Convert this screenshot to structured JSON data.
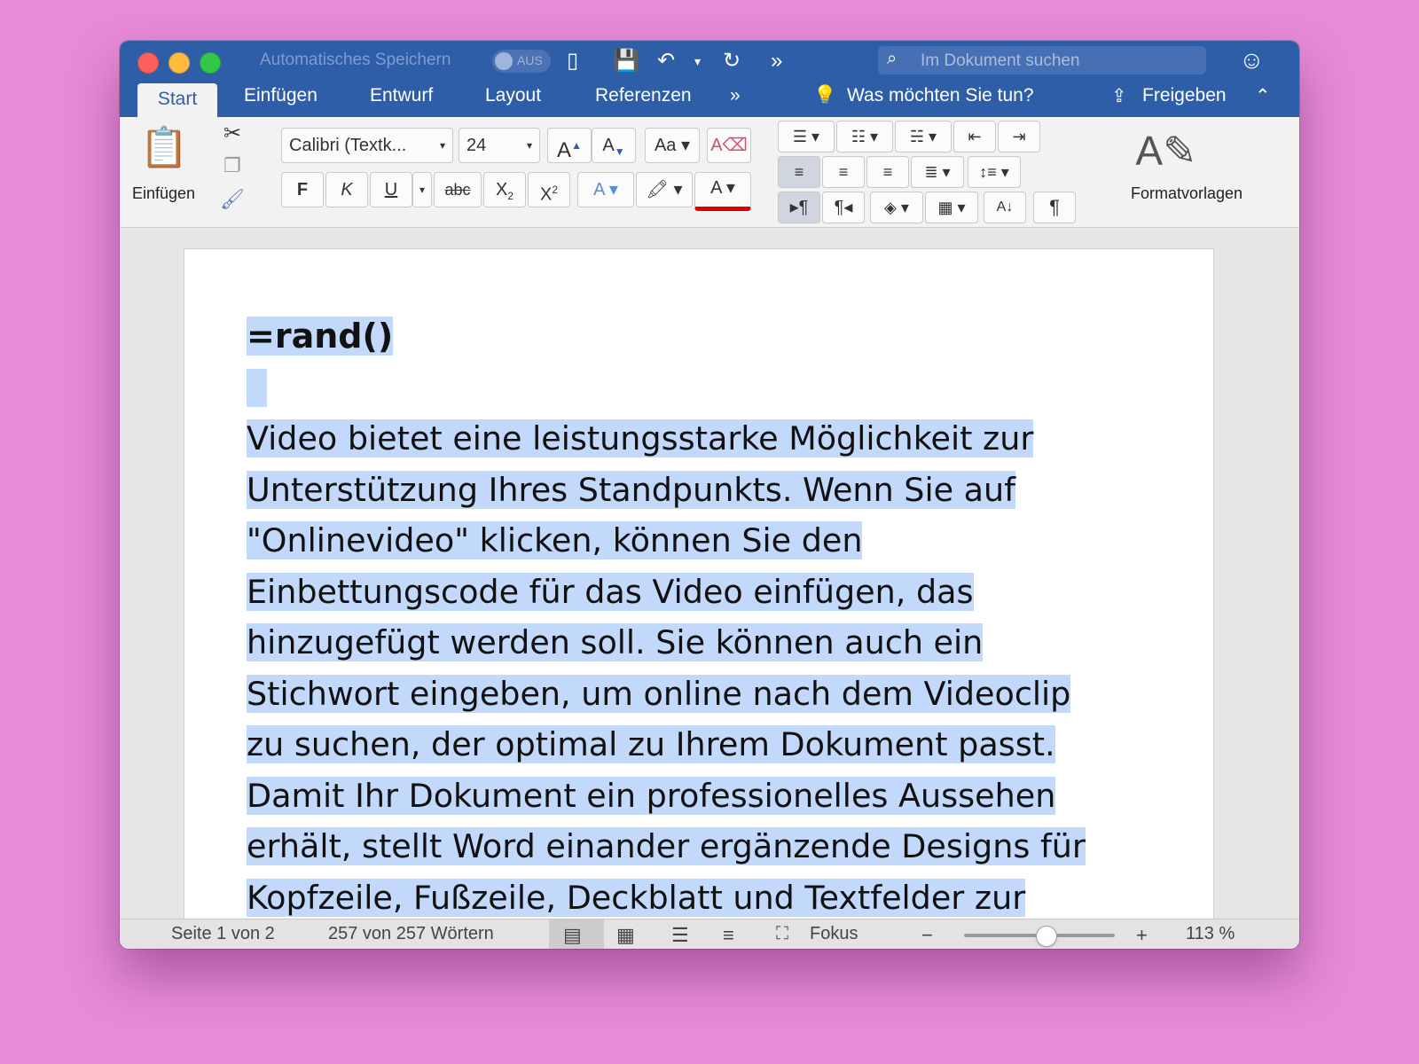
{
  "titlebar": {
    "autosave_label": "Automatisches Speichern",
    "autosave_state": "AUS",
    "search_placeholder": "Im Dokument suchen"
  },
  "tabs": [
    {
      "label": "Start",
      "active": true
    },
    {
      "label": "Einfügen"
    },
    {
      "label": "Entwurf"
    },
    {
      "label": "Layout"
    },
    {
      "label": "Referenzen"
    }
  ],
  "tell_me": "Was möchten Sie tun?",
  "share": "Freigeben",
  "ribbon": {
    "paste_label": "Einfügen",
    "font_name": "Calibri (Textk...",
    "font_size": "24",
    "bold": "F",
    "italic": "K",
    "underline": "U",
    "strike": "abc",
    "styles_label": "Formatvorlagen"
  },
  "document": {
    "heading": "=rand()",
    "lines": [
      "Video bietet eine leistungsstarke Möglichkeit zur",
      "Unterstützung Ihres Standpunkts. Wenn Sie auf",
      "\"Onlinevideo\" klicken, können Sie den",
      "Einbettungscode für das Video einfügen, das",
      "hinzugefügt werden soll. Sie können auch ein",
      "Stichwort eingeben, um online nach dem Videoclip",
      "zu suchen, der optimal zu Ihrem Dokument passt.",
      "Damit Ihr Dokument ein professionelles Aussehen",
      "erhält, stellt Word einander ergänzende Designs für",
      "Kopfzeile, Fußzeile, Deckblatt und Textfelder zur"
    ]
  },
  "status": {
    "page": "Seite 1 von 2",
    "words": "257 von 257 Wörtern",
    "focus": "Fokus",
    "zoom": "113 %",
    "zoom_level": 0.54
  },
  "colors": {
    "accent": "#2f5ea8",
    "selection": "#c3d9fb",
    "highlight": "#f8e000",
    "font_color": "#e00000"
  }
}
